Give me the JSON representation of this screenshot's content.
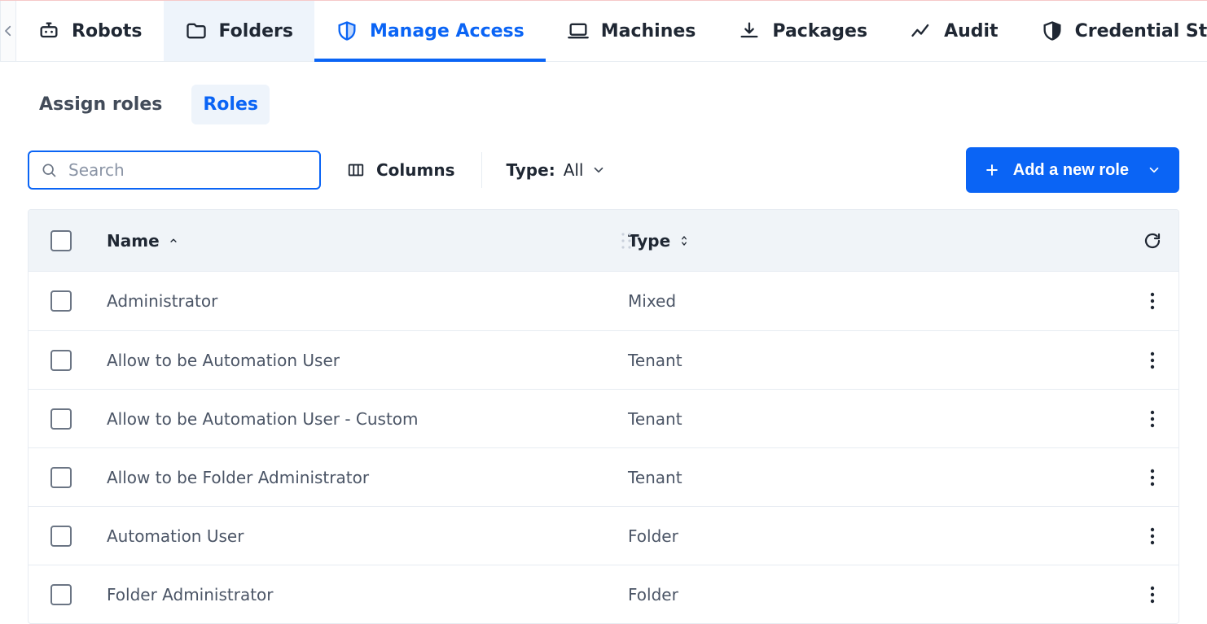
{
  "topnav": {
    "tabs": [
      {
        "label": "Robots",
        "icon": "robot"
      },
      {
        "label": "Folders",
        "icon": "folder"
      },
      {
        "label": "Manage Access",
        "icon": "shield"
      },
      {
        "label": "Machines",
        "icon": "laptop"
      },
      {
        "label": "Packages",
        "icon": "download"
      },
      {
        "label": "Audit",
        "icon": "chart"
      },
      {
        "label": "Credential Stores",
        "icon": "shield-solid"
      }
    ]
  },
  "subtabs": {
    "items": [
      {
        "label": "Assign roles"
      },
      {
        "label": "Roles"
      }
    ]
  },
  "toolbar": {
    "search_placeholder": "Search",
    "columns_label": "Columns",
    "type_label": "Type:",
    "type_value": "All",
    "add_role_label": "Add a new role"
  },
  "table": {
    "headers": {
      "name": "Name",
      "type": "Type"
    },
    "rows": [
      {
        "name": "Administrator",
        "type": "Mixed"
      },
      {
        "name": "Allow to be Automation User",
        "type": "Tenant"
      },
      {
        "name": "Allow to be Automation User - Custom",
        "type": "Tenant"
      },
      {
        "name": "Allow to be Folder Administrator",
        "type": "Tenant"
      },
      {
        "name": "Automation User",
        "type": "Folder"
      },
      {
        "name": "Folder Administrator",
        "type": "Folder"
      }
    ]
  }
}
